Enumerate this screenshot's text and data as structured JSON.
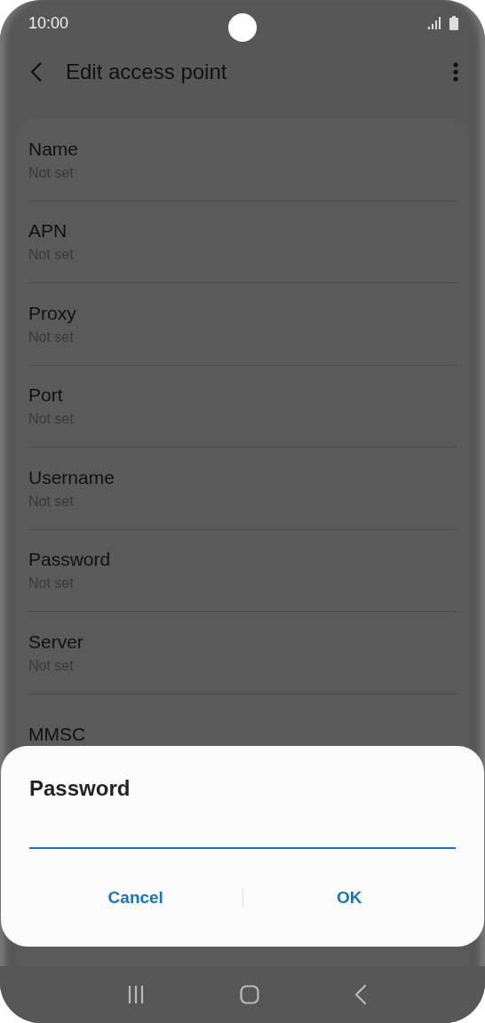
{
  "status_bar": {
    "time": "10:00"
  },
  "header": {
    "title": "Edit access point"
  },
  "settings": [
    {
      "label": "Name",
      "value": "Not set"
    },
    {
      "label": "APN",
      "value": "Not set"
    },
    {
      "label": "Proxy",
      "value": "Not set"
    },
    {
      "label": "Port",
      "value": "Not set"
    },
    {
      "label": "Username",
      "value": "Not set"
    },
    {
      "label": "Password",
      "value": "Not set"
    },
    {
      "label": "Server",
      "value": "Not set"
    },
    {
      "label": "MMSC"
    }
  ],
  "dialog": {
    "title": "Password",
    "buttons": [
      "Cancel",
      "OK"
    ]
  }
}
